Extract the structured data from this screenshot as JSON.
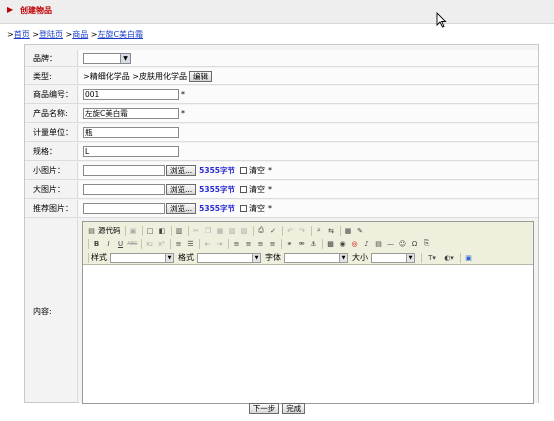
{
  "header": {
    "title": "创建物品"
  },
  "breadcrumb": {
    "prefix": ">",
    "items": [
      "首页",
      "登陆页",
      "商品",
      "左旋C美白霜"
    ]
  },
  "form": {
    "brand": {
      "label": "品牌：",
      "value": ""
    },
    "category": {
      "label": "类型:",
      "value": ">精细化学品 >皮肤用化学品",
      "edit_button": "编辑"
    },
    "product_no": {
      "label": "商品编号：",
      "value": "001",
      "required": "*"
    },
    "product_name": {
      "label": "产品名称:",
      "value": "左旋C美白霜",
      "required": "*"
    },
    "unit": {
      "label": "计量单位：",
      "value": "瓶"
    },
    "spec": {
      "label": "规格：",
      "value": "L"
    },
    "small_image": {
      "label": "小图片：",
      "browse": "浏览...",
      "size": "5355字节",
      "clear": "清空",
      "required": "*"
    },
    "large_image": {
      "label": "大图片：",
      "browse": "浏览...",
      "size": "5355字节",
      "clear": "清空",
      "required": "*"
    },
    "recommend_image": {
      "label": "推荐图片：",
      "browse": "浏览...",
      "size": "5355字节",
      "clear": "清空",
      "required": "*"
    },
    "content": {
      "label": "内容:"
    }
  },
  "editor": {
    "source_label": "源代码",
    "combos": [
      {
        "label": "样式",
        "value": ""
      },
      {
        "label": "格式",
        "value": ""
      },
      {
        "label": "字体",
        "value": ""
      },
      {
        "label": "大小",
        "value": ""
      }
    ],
    "bold": "B",
    "italic": "I",
    "underline": "U",
    "strike": "ABC"
  },
  "actions": {
    "next": "下一步",
    "finish": "完成"
  }
}
